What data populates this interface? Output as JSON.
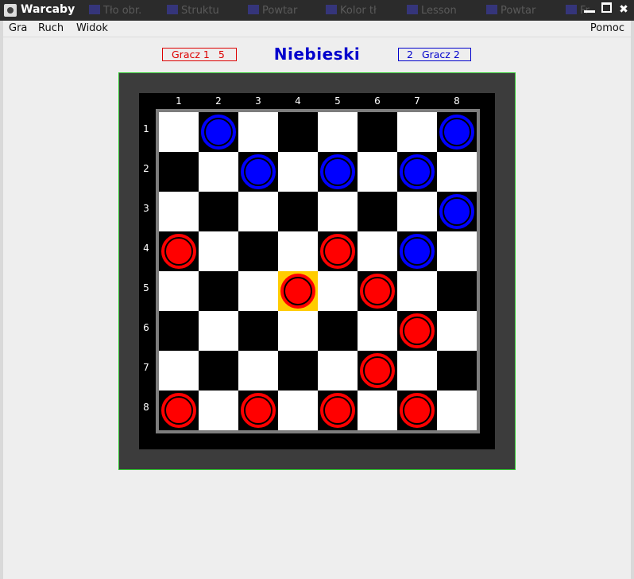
{
  "window": {
    "title": "Warcaby",
    "background_tabs": [
      "Tło obr.",
      "Struktu",
      "Powtar",
      "Kolor tł",
      "Lesson",
      "Powtar",
      "Fr"
    ]
  },
  "menu": {
    "left": [
      "Gra",
      "Ruch",
      "Widok"
    ],
    "right": "Pomoc"
  },
  "header": {
    "player1": {
      "label": "Gracz 1",
      "score": "5",
      "color": "#dd0000"
    },
    "turn": "Niebieski",
    "player2": {
      "label": "Gracz 2",
      "score": "2",
      "color": "#0000cc"
    }
  },
  "board": {
    "size": 8,
    "columns": [
      "1",
      "2",
      "3",
      "4",
      "5",
      "6",
      "7",
      "8"
    ],
    "rows": [
      "1",
      "2",
      "3",
      "4",
      "5",
      "6",
      "7",
      "8"
    ],
    "colors": {
      "dark": "#000000",
      "light": "#ffffff",
      "highlight": "#ffcc00",
      "frame": "#3c3c3c",
      "border": "#33cc33"
    },
    "selected": {
      "row": 5,
      "col": 4
    },
    "pieces": [
      {
        "row": 1,
        "col": 2,
        "color": "blue"
      },
      {
        "row": 1,
        "col": 8,
        "color": "blue"
      },
      {
        "row": 2,
        "col": 3,
        "color": "blue"
      },
      {
        "row": 2,
        "col": 5,
        "color": "blue"
      },
      {
        "row": 2,
        "col": 7,
        "color": "blue"
      },
      {
        "row": 3,
        "col": 8,
        "color": "blue"
      },
      {
        "row": 4,
        "col": 1,
        "color": "red"
      },
      {
        "row": 4,
        "col": 5,
        "color": "red"
      },
      {
        "row": 4,
        "col": 7,
        "color": "blue"
      },
      {
        "row": 5,
        "col": 4,
        "color": "red"
      },
      {
        "row": 5,
        "col": 6,
        "color": "red"
      },
      {
        "row": 6,
        "col": 7,
        "color": "red"
      },
      {
        "row": 7,
        "col": 6,
        "color": "red"
      },
      {
        "row": 8,
        "col": 1,
        "color": "red"
      },
      {
        "row": 8,
        "col": 3,
        "color": "red"
      },
      {
        "row": 8,
        "col": 5,
        "color": "red"
      },
      {
        "row": 8,
        "col": 7,
        "color": "red"
      }
    ]
  }
}
